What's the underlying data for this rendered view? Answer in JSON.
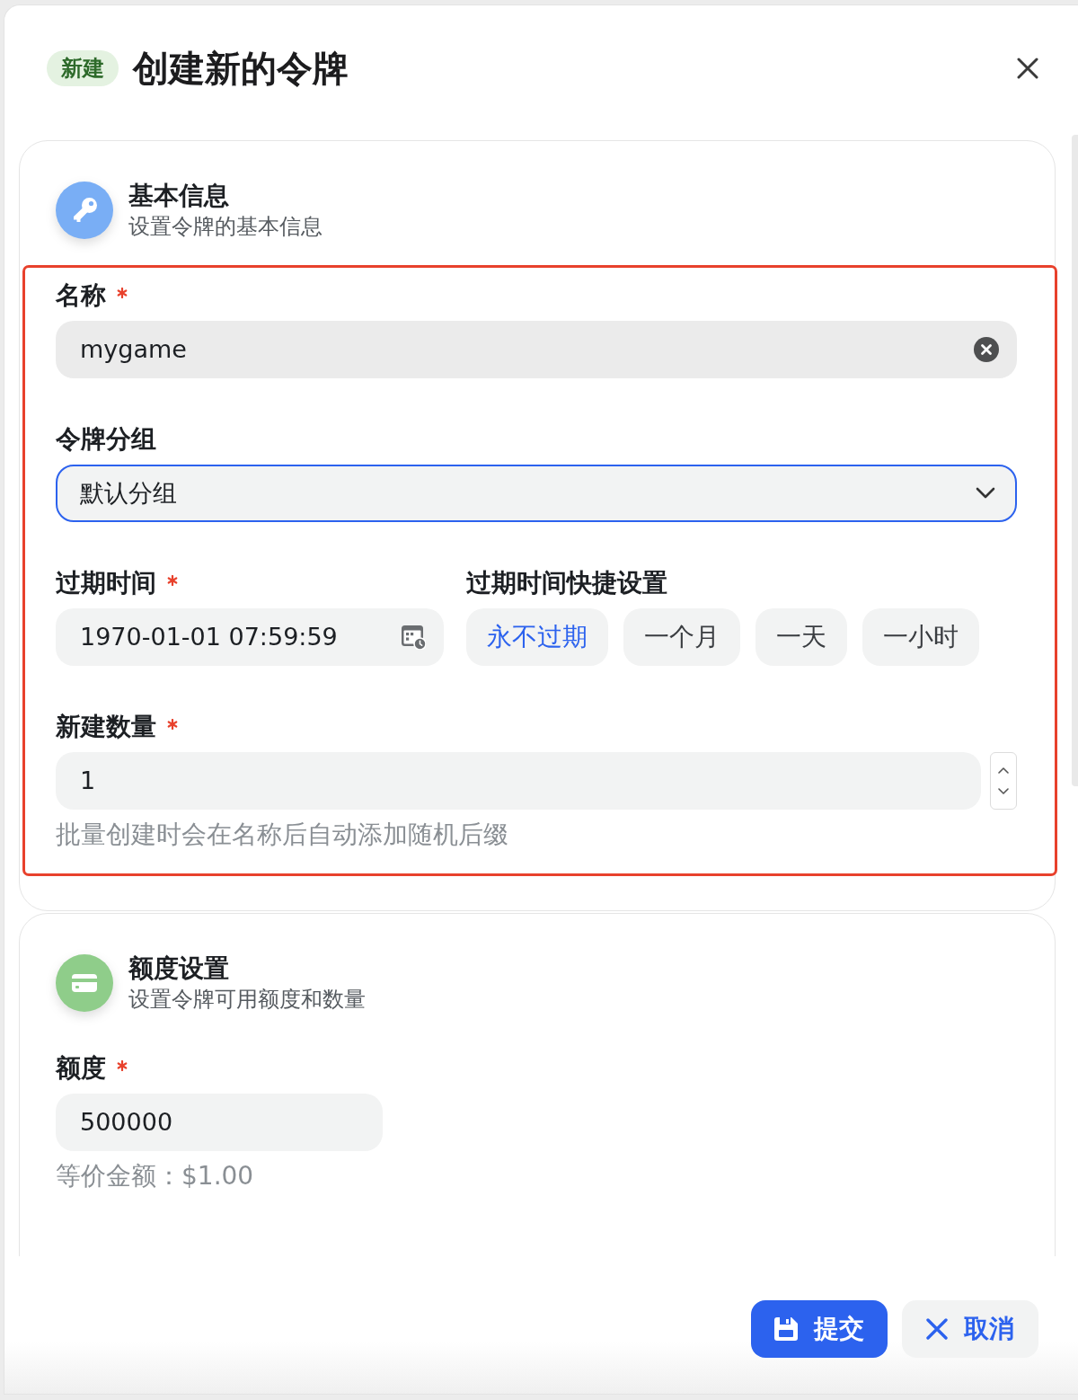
{
  "dialog": {
    "badge": "新建",
    "title": "创建新的令牌"
  },
  "sections": [
    {
      "kind": "basic",
      "title": "基本信息",
      "subtitle": "设置令牌的基本信息",
      "highlighted": true,
      "fields": [
        {
          "kind": "text",
          "label": "名称",
          "required": true,
          "value": "mygame",
          "hovered": true,
          "focused": false
        },
        {
          "kind": "select",
          "label": "令牌分组",
          "required": false,
          "value": "默认分组",
          "hovered": false,
          "focused": true
        },
        {
          "kind": "datetime",
          "label": "过期时间",
          "required": true,
          "value": "1970-01-01 07:59:59",
          "hovered": false,
          "focused": false,
          "presets_label": "过期时间快捷设置",
          "presets": [
            {
              "label": "永不过期",
              "selected": true
            },
            {
              "label": "一个月",
              "selected": false
            },
            {
              "label": "一天",
              "selected": false
            },
            {
              "label": "一小时",
              "selected": false
            }
          ]
        },
        {
          "kind": "number",
          "label": "新建数量",
          "required": true,
          "value": "1",
          "hovered": false,
          "focused": false,
          "help": "批量创建时会在名称后自动添加随机后缀"
        }
      ]
    },
    {
      "kind": "quota",
      "title": "额度设置",
      "subtitle": "设置令牌可用额度和数量",
      "highlighted": false,
      "fields": [
        {
          "kind": "amount",
          "label": "额度",
          "required": true,
          "value": "500000",
          "hovered": false,
          "focused": false,
          "help": "等价金额：$1.00"
        }
      ]
    }
  ],
  "footer": {
    "buttons": [
      {
        "kind": "submit",
        "label": "提交"
      },
      {
        "kind": "cancel",
        "label": "取消"
      }
    ]
  }
}
